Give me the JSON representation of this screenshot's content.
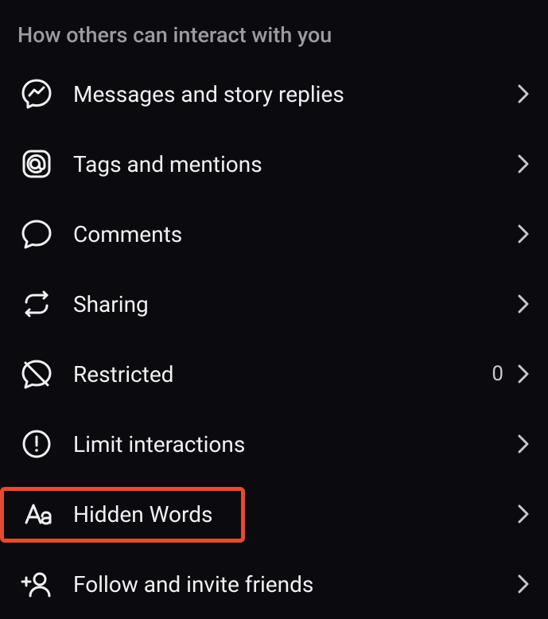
{
  "section_header": "How others can interact with you",
  "items": [
    {
      "icon": "messenger-icon",
      "label": "Messages and story replies",
      "value": null
    },
    {
      "icon": "at-icon",
      "label": "Tags and mentions",
      "value": null
    },
    {
      "icon": "comment-icon",
      "label": "Comments",
      "value": null
    },
    {
      "icon": "share-icon",
      "label": "Sharing",
      "value": null
    },
    {
      "icon": "restricted-icon",
      "label": "Restricted",
      "value": "0"
    },
    {
      "icon": "limit-icon",
      "label": "Limit interactions",
      "value": null
    },
    {
      "icon": "hidden-words-icon",
      "label": "Hidden Words",
      "value": null,
      "highlighted": true
    },
    {
      "icon": "follow-invite-icon",
      "label": "Follow and invite friends",
      "value": null
    }
  ]
}
